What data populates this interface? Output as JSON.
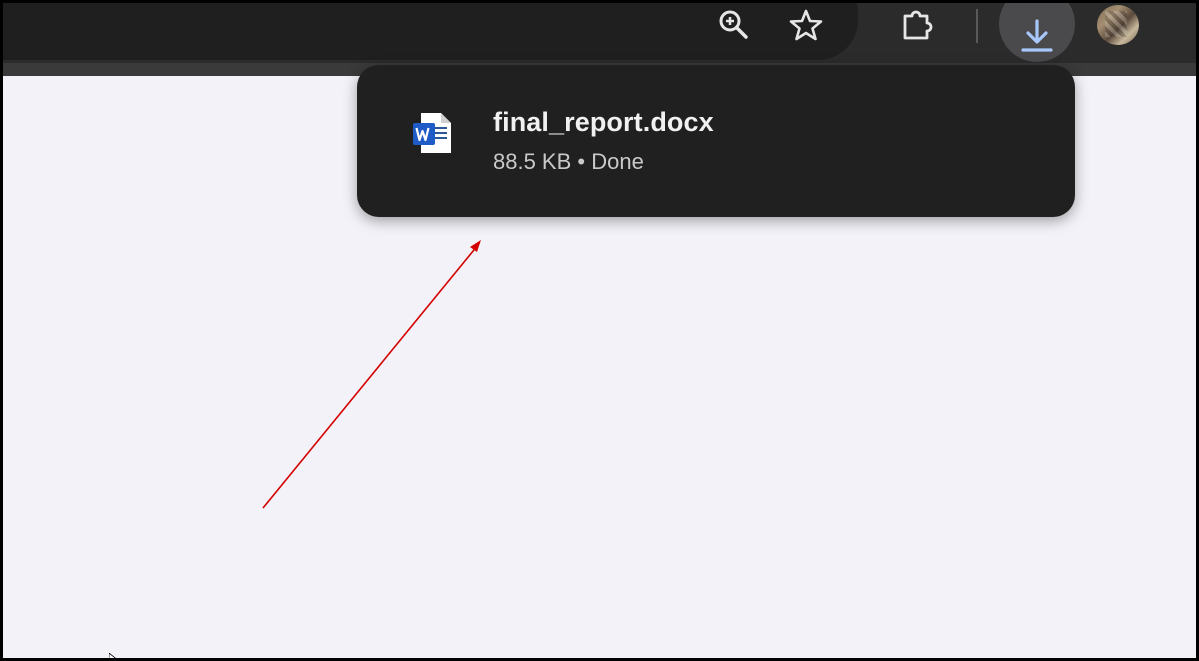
{
  "toolbar": {
    "icons": {
      "zoom": "zoom-magnifier-icon",
      "bookmark": "star-icon",
      "extensions": "puzzle-piece-icon",
      "downloads": "download-arrow-icon",
      "profile": "profile-avatar"
    },
    "colors": {
      "toolbar_bg": "#2b2b2b",
      "omnibox_bg": "#1f1f1f",
      "download_button_bg": "#4a4a4c",
      "download_icon": "#a8c7fa"
    }
  },
  "downloads_bubble": {
    "item": {
      "file_name": "final_report.docx",
      "status": "88.5 KB • Done",
      "file_icon": "word-document-icon"
    },
    "colors": {
      "background": "#202020",
      "title": "#f1f1f1",
      "subtitle": "#c9c9c9"
    }
  },
  "annotation": {
    "type": "arrow",
    "color": "#d40000"
  },
  "page": {
    "background": "#f3f2f8"
  }
}
